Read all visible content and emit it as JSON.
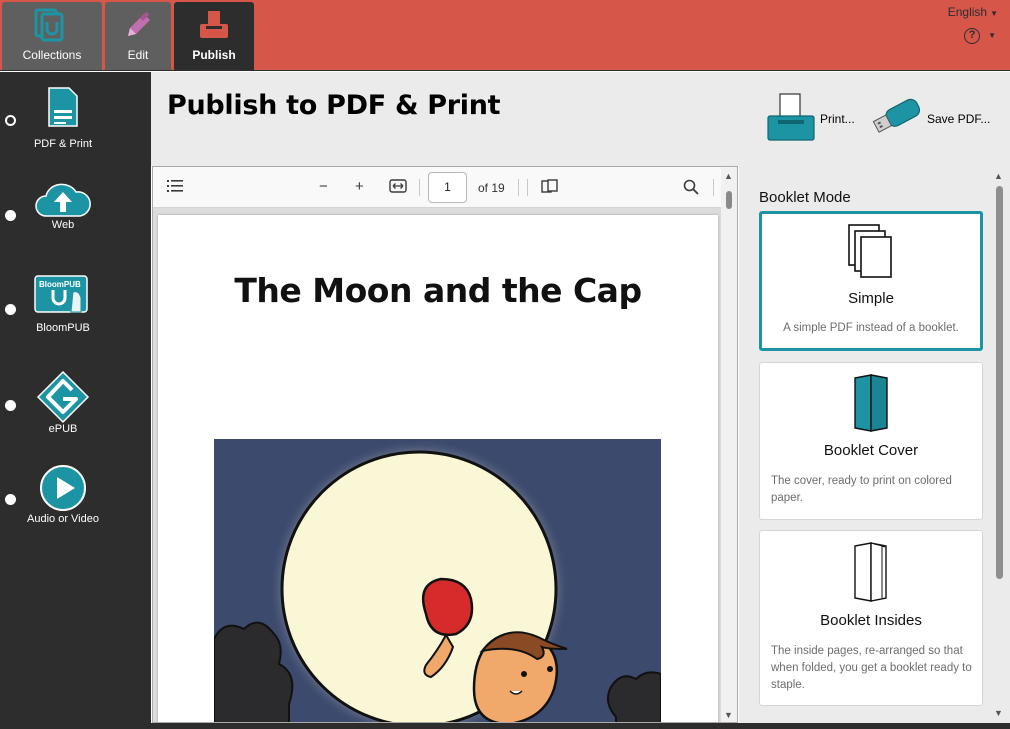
{
  "top_tabs": [
    {
      "label": "Collections"
    },
    {
      "label": "Edit"
    },
    {
      "label": "Publish"
    }
  ],
  "language": {
    "label": "English"
  },
  "sidebar": {
    "items": [
      {
        "label": "PDF & Print",
        "selected": true
      },
      {
        "label": "Web",
        "selected": false
      },
      {
        "label": "BloomPUB",
        "selected": false,
        "badge": "BloomPUB"
      },
      {
        "label": "ePUB",
        "selected": false
      },
      {
        "label": "Audio or Video",
        "selected": false
      }
    ]
  },
  "header": {
    "title": "Publish to PDF & Print",
    "print_label": "Print...",
    "save_label": "Save PDF..."
  },
  "viewer": {
    "current_page": "1",
    "page_count_text": "of 19",
    "book_title": "The Moon and the Cap"
  },
  "booklet": {
    "title": "Booklet Mode",
    "options": [
      {
        "name": "Simple",
        "description": "A simple PDF instead of a booklet.",
        "selected": true
      },
      {
        "name": "Booklet Cover",
        "description": "The cover, ready to print on colored paper.",
        "selected": false
      },
      {
        "name": "Booklet Insides",
        "description": "The inside pages, re-arranged so that when folded, you get a booklet ready to staple.",
        "selected": false
      }
    ]
  },
  "colors": {
    "top_bar": "#d65649",
    "sidebar": "#2d2d2d",
    "accent_teal": "#1d94a4",
    "header_bg": "#ebebeb"
  }
}
